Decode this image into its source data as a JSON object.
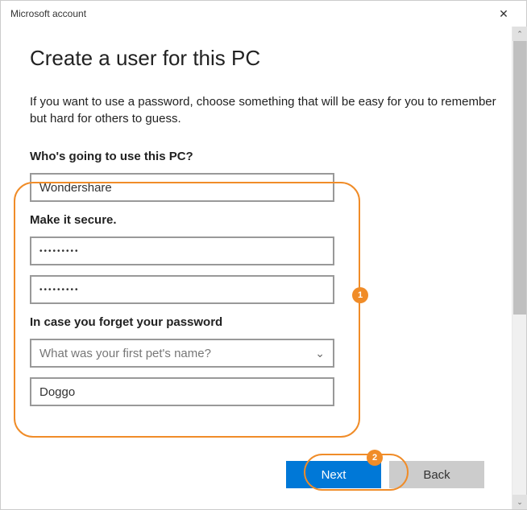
{
  "window": {
    "title": "Microsoft account"
  },
  "page": {
    "heading": "Create a user for this PC",
    "intro": "If you want to use a password, choose something that will be easy for you to remember but hard for others to guess."
  },
  "form": {
    "username_label": "Who's going to use this PC?",
    "username_value": "Wondershare",
    "password_label": "Make it secure.",
    "password_value": "•••••••••",
    "password_confirm_value": "•••••••••",
    "security_label": "In case you forget your password",
    "security_question_placeholder": "What was your first pet's name?",
    "security_answer_value": "Doggo"
  },
  "buttons": {
    "next": "Next",
    "back": "Back"
  },
  "annotations": {
    "badge1": "1",
    "badge2": "2"
  }
}
